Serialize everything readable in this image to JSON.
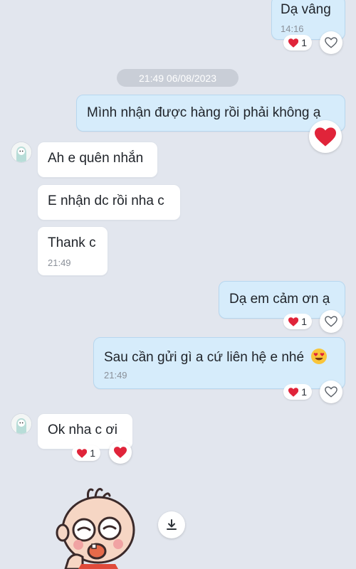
{
  "colors": {
    "background": "#e2e6ee",
    "outgoing_bubble": "#d6ecfb",
    "incoming_bubble": "#ffffff",
    "heart": "#e0243a"
  },
  "date_separator": "21:49 06/08/2023",
  "messages": [
    {
      "text": "Dạ vâng",
      "time": "14:16",
      "reaction_count": "1",
      "reaction_icon": "heart-icon"
    },
    {
      "text": "Mình nhận được hàng rồi phải không ạ",
      "reaction_icon": "heart-icon"
    },
    {
      "text": "Ah e quên nhắn"
    },
    {
      "text": "E nhận dc rồi nha c"
    },
    {
      "text": "Thank c",
      "time": "21:49"
    },
    {
      "text": "Dạ em cảm ơn ạ",
      "reaction_count": "1",
      "reaction_icon": "heart-icon"
    },
    {
      "text": "Sau cần gửi gì a cứ liên hệ e nhé",
      "time": "21:49",
      "reaction_count": "1",
      "reaction_icon": "heart-icon",
      "emoji_icon": "heart-eyes-emoji-icon"
    },
    {
      "text": "Ok nha c ơi",
      "reaction_count": "1",
      "reaction_icon": "heart-icon"
    }
  ],
  "icons": {
    "download": "download-icon",
    "react_add": "heart-outline-icon",
    "avatar": "avatar-icon",
    "sticker": "baby-sticker-icon"
  }
}
